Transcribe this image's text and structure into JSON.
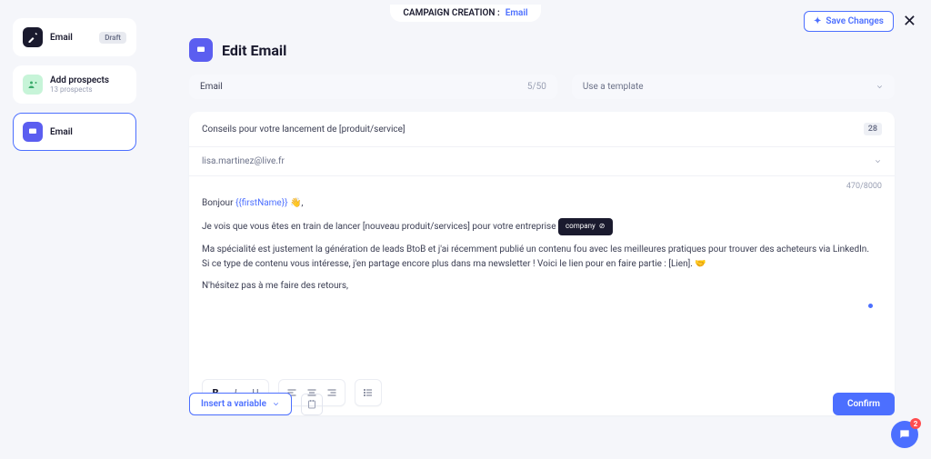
{
  "top": {
    "label": "CAMPAIGN CREATION :",
    "link": "Email",
    "save": "Save Changes"
  },
  "sidebar": {
    "items": [
      {
        "title": "Email",
        "badge": "Draft"
      },
      {
        "title": "Add prospects",
        "sub": "13 prospects"
      },
      {
        "title": "Email"
      }
    ]
  },
  "header": {
    "title": "Edit Email"
  },
  "nameField": {
    "label": "Email",
    "count": "5/50"
  },
  "template": {
    "placeholder": "Use a template"
  },
  "subject": {
    "value": "Conseils pour votre lancement de [produit/service]",
    "count": "28"
  },
  "from": {
    "value": "lisa.martinez@live.fr"
  },
  "charCount": "470/8000",
  "body": {
    "greeting_pre": "Bonjour ",
    "greeting_var": "{{firstName}}",
    "greeting_post": " 👋,",
    "p2_pre": "Je vois que vous êtes en train de lancer [nouveau produit/services] pour votre entreprise ",
    "p2_chip": "company",
    "p3": "Ma spécialité est justement la génération de leads BtoB et j'ai récemment publié un contenu fou avec les meilleures pratiques pour trouver des acheteurs via LinkedIn.",
    "p4": "Si ce type de contenu vous intéresse, j'en partage encore plus dans ma newsletter ! Voici le lien pour en faire partie : [Lien]. 🤝",
    "p5": "N'hésitez pas à me faire des retours,"
  },
  "footer": {
    "insert": "Insert a variable",
    "confirm": "Confirm"
  },
  "chat": {
    "badge": "2"
  }
}
